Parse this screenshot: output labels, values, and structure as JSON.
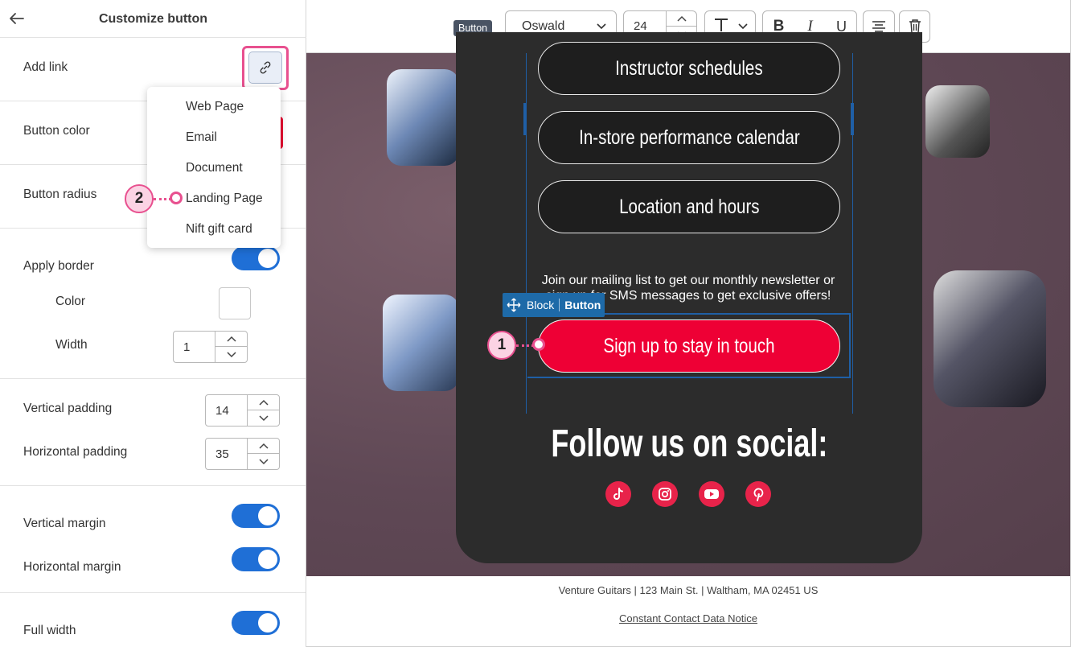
{
  "panel": {
    "title": "Customize button",
    "add_link_label": "Add link",
    "button_color_label": "Button color",
    "button_radius_label": "Button radius",
    "apply_border_label": "Apply border",
    "color_label": "Color",
    "width_label": "Width",
    "width_value": "1",
    "vertical_padding_label": "Vertical padding",
    "vertical_padding_value": "14",
    "horizontal_padding_label": "Horizontal padding",
    "horizontal_padding_value": "35",
    "vertical_margin_label": "Vertical margin",
    "horizontal_margin_label": "Horizontal margin",
    "full_width_label": "Full width",
    "button_color_hex": "#e8002f"
  },
  "link_menu": {
    "options": [
      "Web Page",
      "Email",
      "Document",
      "Landing Page",
      "Nift gift card"
    ]
  },
  "toolbar": {
    "badge": "Button",
    "font": "Oswald",
    "font_size": "24"
  },
  "email": {
    "buttons": [
      "Instructor schedules",
      "In-store performance calendar",
      "Location and hours"
    ],
    "join_text": "Join our mailing list to get our monthly newsletter or sign up for SMS messages to get exclusive offers!",
    "block_tag_block": "Block",
    "block_tag_button": "Button",
    "signup_button": "Sign up to stay in touch",
    "follow_heading": "Follow us on social:",
    "social_icons": [
      "tiktok-icon",
      "instagram-icon",
      "youtube-icon",
      "pinterest-icon"
    ],
    "accent_color": "#ee0035"
  },
  "footer": {
    "address": "Venture Guitars | 123 Main St. | Waltham, MA 02451 US",
    "notice": "Constant Contact Data Notice"
  },
  "callouts": [
    "1",
    "2"
  ]
}
